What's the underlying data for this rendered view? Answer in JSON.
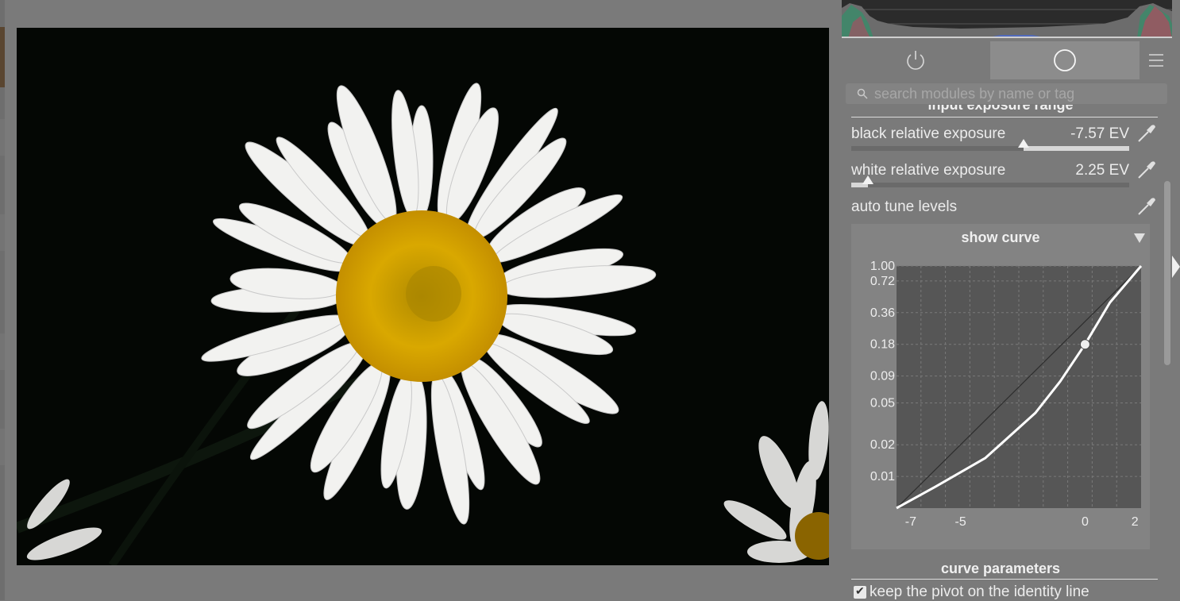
{
  "search": {
    "placeholder": "search modules by name or tag"
  },
  "icons": {
    "search": "search-icon",
    "power": "power-icon",
    "active_modules": "circle-icon",
    "presets": "hamburger-menu-icon",
    "picker": "color-picker-icon",
    "collapse": "triangle-down-icon",
    "expand_right": "triangle-right-icon"
  },
  "module": {
    "section_title": "input exposure range",
    "black": {
      "label": "black relative exposure",
      "value": "-7.57 EV",
      "level": 0.62
    },
    "white": {
      "label": "white relative exposure",
      "value": "2.25 EV",
      "level": 0.06
    },
    "auto_tune": {
      "label": "auto tune levels"
    },
    "show_curve": {
      "label": "show curve"
    },
    "curve_parameters": {
      "label": "curve parameters"
    },
    "keep_pivot": {
      "label": "keep the pivot on the identity line",
      "checked": true
    }
  },
  "chart_data": {
    "type": "line",
    "title": "",
    "xlabel": "",
    "ylabel": "",
    "xlim": [
      -7.57,
      2.25
    ],
    "ylim": [
      0,
      1
    ],
    "y_scale": "log",
    "x_ticks": [
      "-7",
      "-5",
      "0",
      "2"
    ],
    "y_ticks": [
      "1.00",
      "0.72",
      "0.36",
      "0.18",
      "0.09",
      "0.05",
      "0.02",
      "0.01"
    ],
    "grid": true,
    "series": [
      {
        "x": [
          -7.57,
          -6,
          -4,
          -2,
          -1,
          0,
          1,
          2.25
        ],
        "y": [
          0.005,
          0.008,
          0.015,
          0.04,
          0.08,
          0.18,
          0.45,
          1.0
        ]
      }
    ],
    "pivot": {
      "x": 0,
      "y": 0.18
    }
  }
}
